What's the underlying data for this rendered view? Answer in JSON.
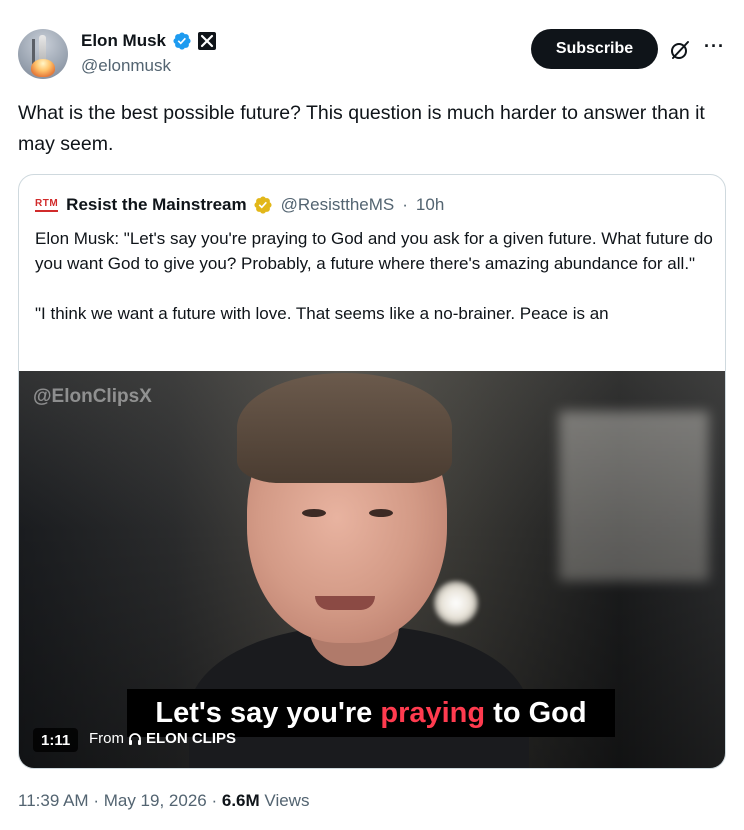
{
  "author": {
    "name": "Elon Musk",
    "handle": "@elonmusk"
  },
  "actions": {
    "subscribe_label": "Subscribe",
    "more_label": "···"
  },
  "tweet": {
    "text": "What is the best possible future? This question is much harder to answer than it may seem."
  },
  "quoted": {
    "logo_text": "RTM",
    "name": "Resist the Mainstream",
    "handle": "@ResisttheMS",
    "separator": "·",
    "time": "10h",
    "paragraph1": "Elon Musk: \"Let's say you're praying to God and you ask for a given future. What future do you want God to give you? Probably, a future where there's amazing abundance for all.\"",
    "paragraph2": "\"I think we want a future with love. That seems like a no-brainer. Peace is an"
  },
  "video": {
    "watermark": "@ElonClipsX",
    "caption_pre": "Let's say you're ",
    "caption_highlight": "praying",
    "caption_post": " to God",
    "duration": "1:11",
    "from_label": "From",
    "source": "ELON CLIPS"
  },
  "meta": {
    "time": "11:39 AM",
    "sep1": "·",
    "date": "May 19, 2026",
    "sep2": "·",
    "views_count": "6.6M",
    "views_label": "Views"
  },
  "colors": {
    "verified_blue": "#1d9bf0",
    "verified_gold": "#e2b719",
    "caption_highlight": "#ff3b4f"
  }
}
